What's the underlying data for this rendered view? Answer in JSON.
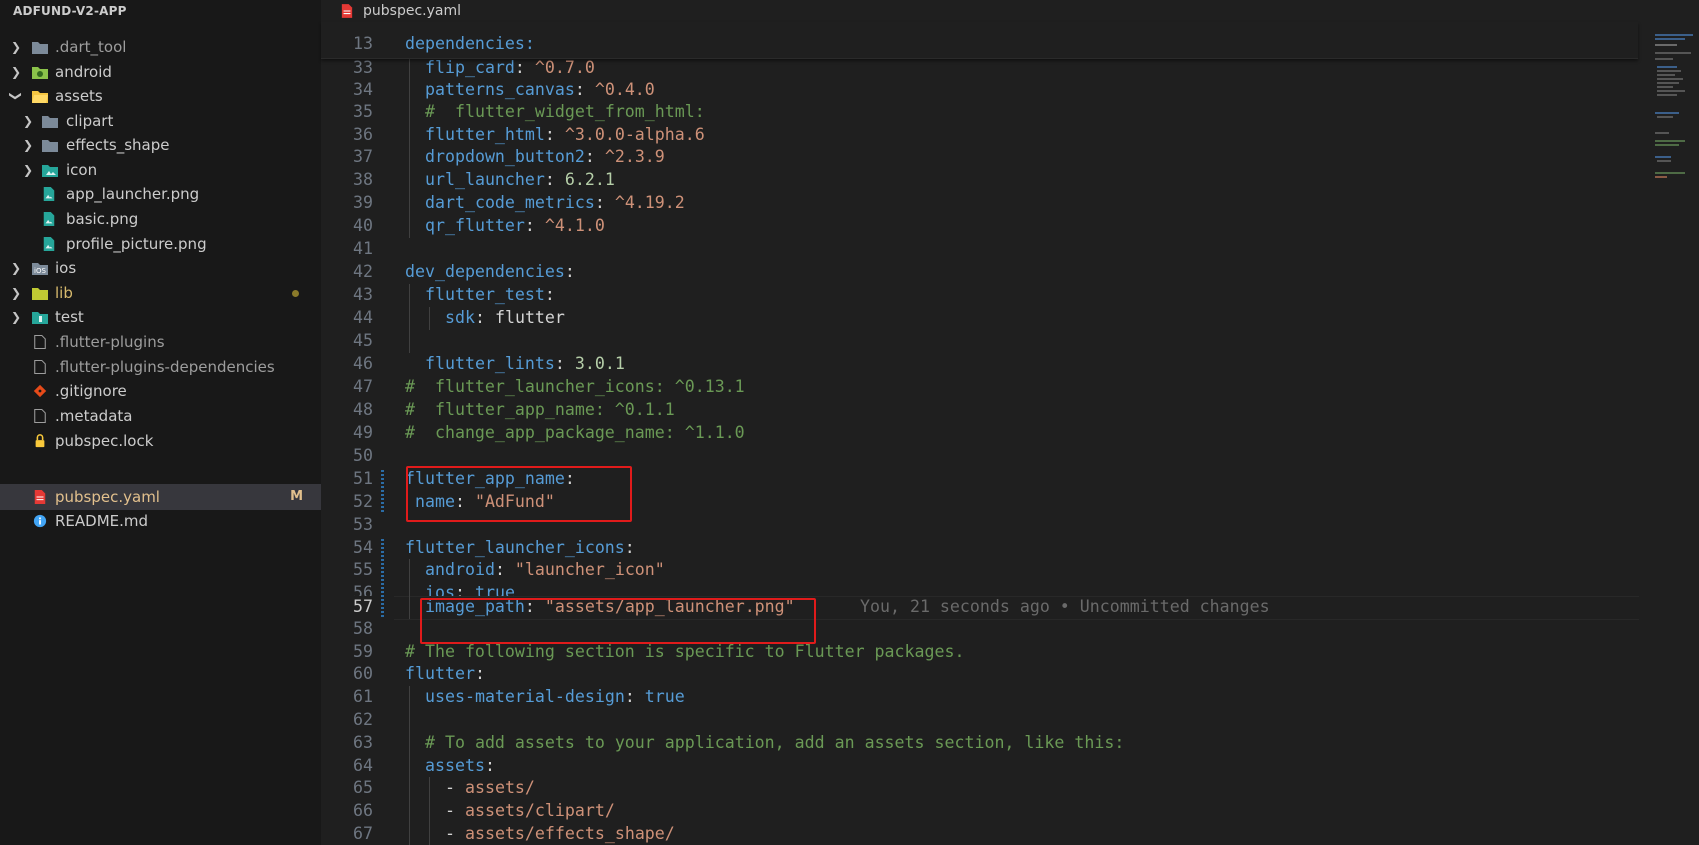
{
  "explorer": {
    "root_title": "ADFUND-V2-APP",
    "items": [
      {
        "label": ".dart_tool",
        "type": "folder",
        "collapsed": true
      },
      {
        "label": "android",
        "type": "folder",
        "collapsed": true
      },
      {
        "label": "assets",
        "type": "folder",
        "collapsed": false
      },
      {
        "label": "clipart",
        "type": "folder",
        "collapsed": true
      },
      {
        "label": "effects_shape",
        "type": "folder",
        "collapsed": true
      },
      {
        "label": "icon",
        "type": "folder",
        "collapsed": true
      },
      {
        "label": "app_launcher.png",
        "type": "image"
      },
      {
        "label": "basic.png",
        "type": "image"
      },
      {
        "label": "profile_picture.png",
        "type": "image"
      },
      {
        "label": "ios",
        "type": "folder",
        "collapsed": true
      },
      {
        "label": "lib",
        "type": "folder",
        "collapsed": true
      },
      {
        "label": "test",
        "type": "folder",
        "collapsed": true
      },
      {
        "label": ".flutter-plugins",
        "type": "file"
      },
      {
        "label": ".flutter-plugins-dependencies",
        "type": "file"
      },
      {
        "label": ".gitignore",
        "type": "git"
      },
      {
        "label": ".metadata",
        "type": "file"
      },
      {
        "label": "pubspec.lock",
        "type": "lock"
      },
      {
        "label": "pubspec.yaml",
        "type": "yaml",
        "badge": "M",
        "active": true
      },
      {
        "label": "README.md",
        "type": "info"
      }
    ]
  },
  "tab": {
    "label": "pubspec.yaml"
  },
  "sticky": {
    "line_number": "13",
    "text": "dependencies:"
  },
  "lines": {
    "l33": {
      "n": "33",
      "key": "flip_card",
      "val": "^0.7.0"
    },
    "l34": {
      "n": "34",
      "key": "patterns_canvas",
      "val": "^0.4.0"
    },
    "l35": {
      "n": "35",
      "comment": "#  flutter_widget_from_html:"
    },
    "l36": {
      "n": "36",
      "key": "flutter_html",
      "val": "^3.0.0-alpha.6"
    },
    "l37": {
      "n": "37",
      "key": "dropdown_button2",
      "val": "^2.3.9"
    },
    "l38": {
      "n": "38",
      "key": "url_launcher",
      "val": "6.2.1"
    },
    "l39": {
      "n": "39",
      "key": "dart_code_metrics",
      "val": "^4.19.2"
    },
    "l40": {
      "n": "40",
      "key": "qr_flutter",
      "val": "^4.1.0"
    },
    "l41": {
      "n": "41"
    },
    "l42": {
      "n": "42",
      "key": "dev_dependencies"
    },
    "l43": {
      "n": "43",
      "key": "flutter_test"
    },
    "l44": {
      "n": "44",
      "key": "sdk",
      "val": "flutter"
    },
    "l45": {
      "n": "45"
    },
    "l46": {
      "n": "46",
      "key": "flutter_lints",
      "val": "3.0.1"
    },
    "l47": {
      "n": "47",
      "comment": "#  flutter_launcher_icons: ^0.13.1"
    },
    "l48": {
      "n": "48",
      "comment": "#  flutter_app_name: ^0.1.1"
    },
    "l49": {
      "n": "49",
      "comment": "#  change_app_package_name: ^1.1.0"
    },
    "l50": {
      "n": "50"
    },
    "l51": {
      "n": "51",
      "key": "flutter_app_name"
    },
    "l52": {
      "n": "52",
      "key": "name",
      "val": "\"AdFund\""
    },
    "l53": {
      "n": "53"
    },
    "l54": {
      "n": "54",
      "key": "flutter_launcher_icons"
    },
    "l55": {
      "n": "55",
      "key": "android",
      "val": "\"launcher_icon\""
    },
    "l56": {
      "n": "56",
      "key": "ios",
      "val": "true"
    },
    "l57": {
      "n": "57",
      "key": "image_path",
      "val": "\"assets/app_launcher.png\"",
      "blame": "You, 21 seconds ago • Uncommitted changes"
    },
    "l58": {
      "n": "58"
    },
    "l59": {
      "n": "59",
      "comment": "# The following section is specific to Flutter packages."
    },
    "l60": {
      "n": "60",
      "key": "flutter"
    },
    "l61": {
      "n": "61",
      "key": "uses-material-design",
      "val": "true"
    },
    "l62": {
      "n": "62"
    },
    "l63": {
      "n": "63",
      "comment": "# To add assets to your application, add an assets section, like this:"
    },
    "l64": {
      "n": "64",
      "key": "assets"
    },
    "l65": {
      "n": "65",
      "val": "assets/"
    },
    "l66": {
      "n": "66",
      "val": "assets/clipart/"
    },
    "l67": {
      "n": "67",
      "val": "assets/effects_shape/"
    }
  },
  "colors": {
    "keyword": "#569cd6",
    "string": "#ce9178",
    "number": "#b5cea8",
    "comment": "#6a9955",
    "highlight_box": "#e01b1b",
    "modified_badge": "#e2c08d"
  }
}
